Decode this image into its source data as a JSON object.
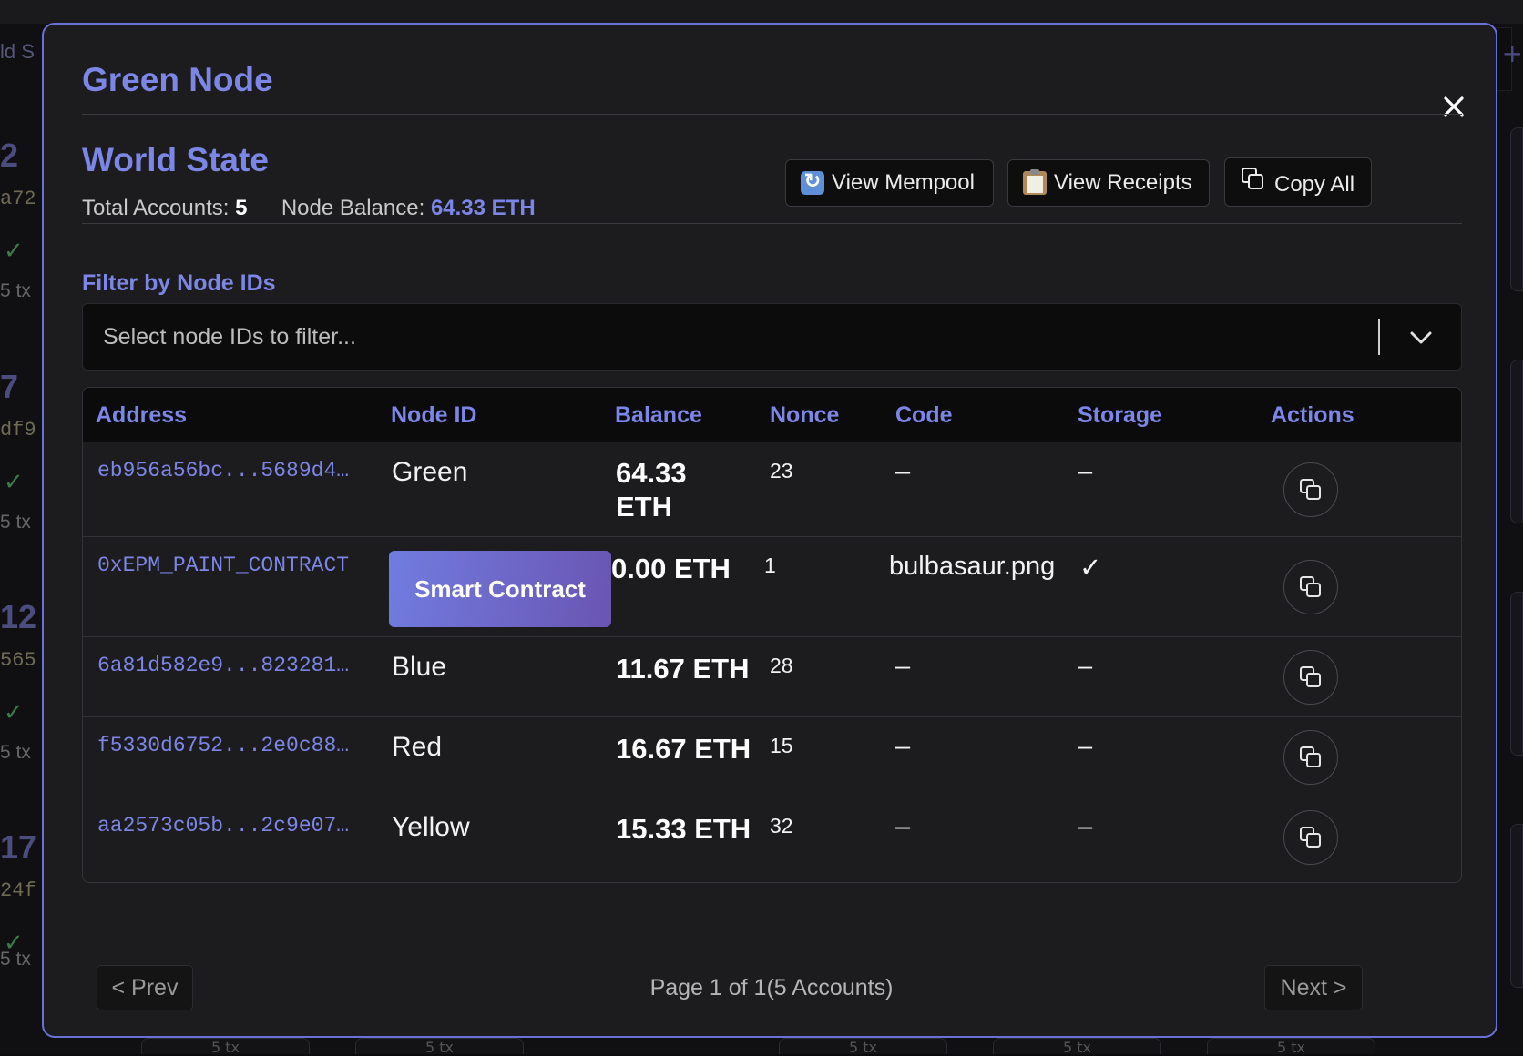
{
  "modal": {
    "title": "Green Node",
    "close_icon": "close-icon",
    "world_state": {
      "title": "World State",
      "total_accounts_label": "Total Accounts:",
      "total_accounts_value": "5",
      "node_balance_label": "Node Balance:",
      "node_balance_value": "64.33 ETH"
    },
    "toolbar": {
      "view_mempool": {
        "icon": "refresh-icon",
        "label": "View Mempool"
      },
      "view_receipts": {
        "icon": "clipboard-icon",
        "label": "View Receipts"
      },
      "copy_all": {
        "icon": "copy-icon",
        "label": "Copy All"
      }
    },
    "filter": {
      "label": "Filter by Node IDs",
      "placeholder": "Select node IDs to filter...",
      "chevron_icon": "chevron-down-icon"
    },
    "table": {
      "columns": [
        "Address",
        "Node ID",
        "Balance",
        "Nonce",
        "Code",
        "Storage",
        "Actions"
      ],
      "rows": [
        {
          "address": "eb956a56bc...5689d4…",
          "node_id": "Green",
          "balance": "64.33 ETH",
          "nonce": "23",
          "code": "–",
          "storage": "–",
          "action_icon": "copy-icon"
        },
        {
          "address": "0xEPM_PAINT_CONTRACT",
          "node_id": "Smart Contract",
          "balance": "0.00 ETH",
          "nonce": "1",
          "code": "bulbasaur.png",
          "storage": "✓",
          "action_icon": "copy-icon"
        },
        {
          "address": "6a81d582e9...823281…",
          "node_id": "Blue",
          "balance": "11.67 ETH",
          "nonce": "28",
          "code": "–",
          "storage": "–",
          "action_icon": "copy-icon"
        },
        {
          "address": "f5330d6752...2e0c88…",
          "node_id": "Red",
          "balance": "16.67 ETH",
          "nonce": "15",
          "code": "–",
          "storage": "–",
          "action_icon": "copy-icon"
        },
        {
          "address": "aa2573c05b...2c9e07…",
          "node_id": "Yellow",
          "balance": "15.33 ETH",
          "nonce": "32",
          "code": "–",
          "storage": "–",
          "action_icon": "copy-icon"
        }
      ]
    },
    "pagination": {
      "prev_label": "< Prev",
      "info": "Page 1 of 1(5 Accounts)",
      "next_label": "Next >"
    }
  },
  "background": {
    "left_label": "ld S",
    "blocks": [
      {
        "number": "2",
        "hash": "a72",
        "tx": "5 tx"
      },
      {
        "number": "7",
        "hash": "df9",
        "tx": "5 tx"
      },
      {
        "number": "12",
        "hash": "565",
        "tx": "5 tx"
      },
      {
        "number": "17",
        "hash": "24f",
        "tx": "5 tx"
      }
    ],
    "bottom_pills": [
      "5 tx",
      "5 tx",
      "5 tx",
      "5 tx",
      "5 tx"
    ],
    "plus_icon": "plus-icon"
  },
  "colors": {
    "accent": "#7c86e6",
    "modal_border": "#6a70d8",
    "modal_bg": "#1c1c1e",
    "badge_gradient_start": "#717ce0",
    "badge_gradient_end": "#6a55b2"
  }
}
